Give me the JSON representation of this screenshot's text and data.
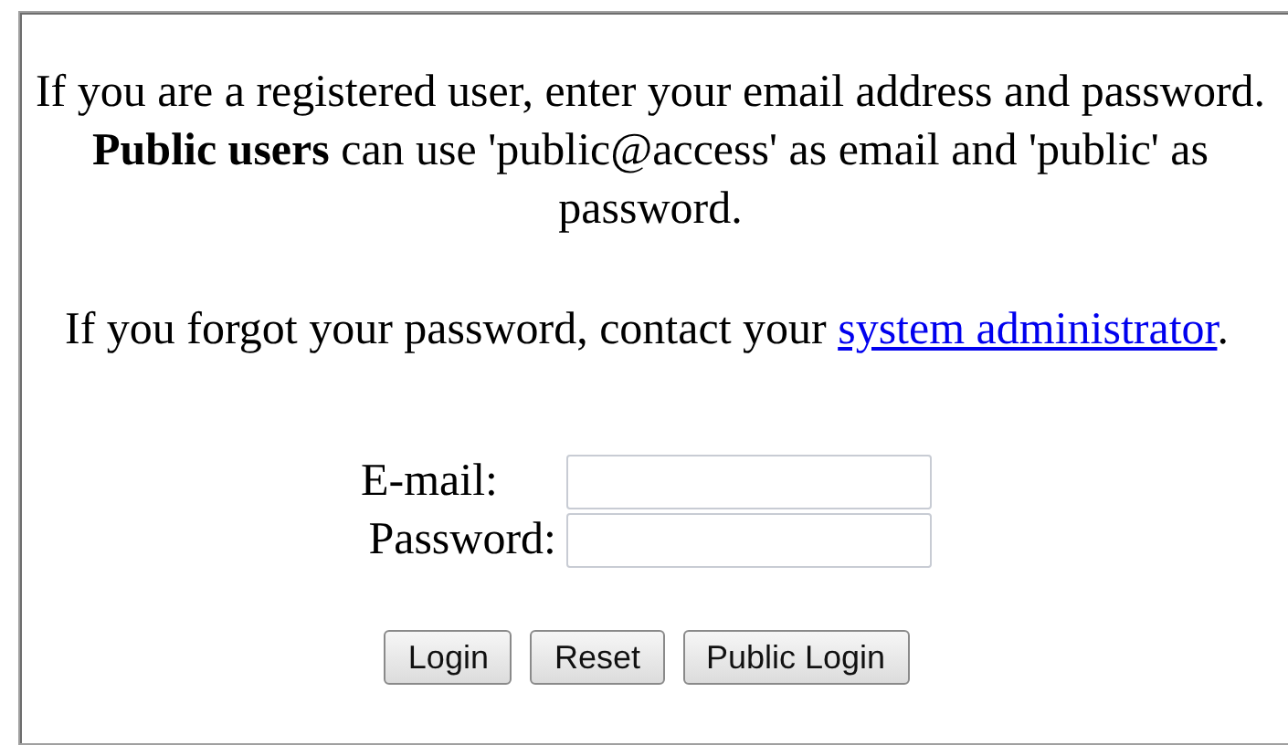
{
  "intro": "If you are a registered user, enter your email address and password. **Public users** can use 'public@access' as email and 'public' as password.",
  "forgot": {
    "text": "If you forgot your password, contact your ",
    "link": "system administrator",
    "after": "."
  },
  "fields": [
    {
      "label": "E-mail:"
    },
    {
      "label": "Password:"
    }
  ],
  "buttons": [
    "Login",
    "Reset",
    "Public Login"
  ]
}
